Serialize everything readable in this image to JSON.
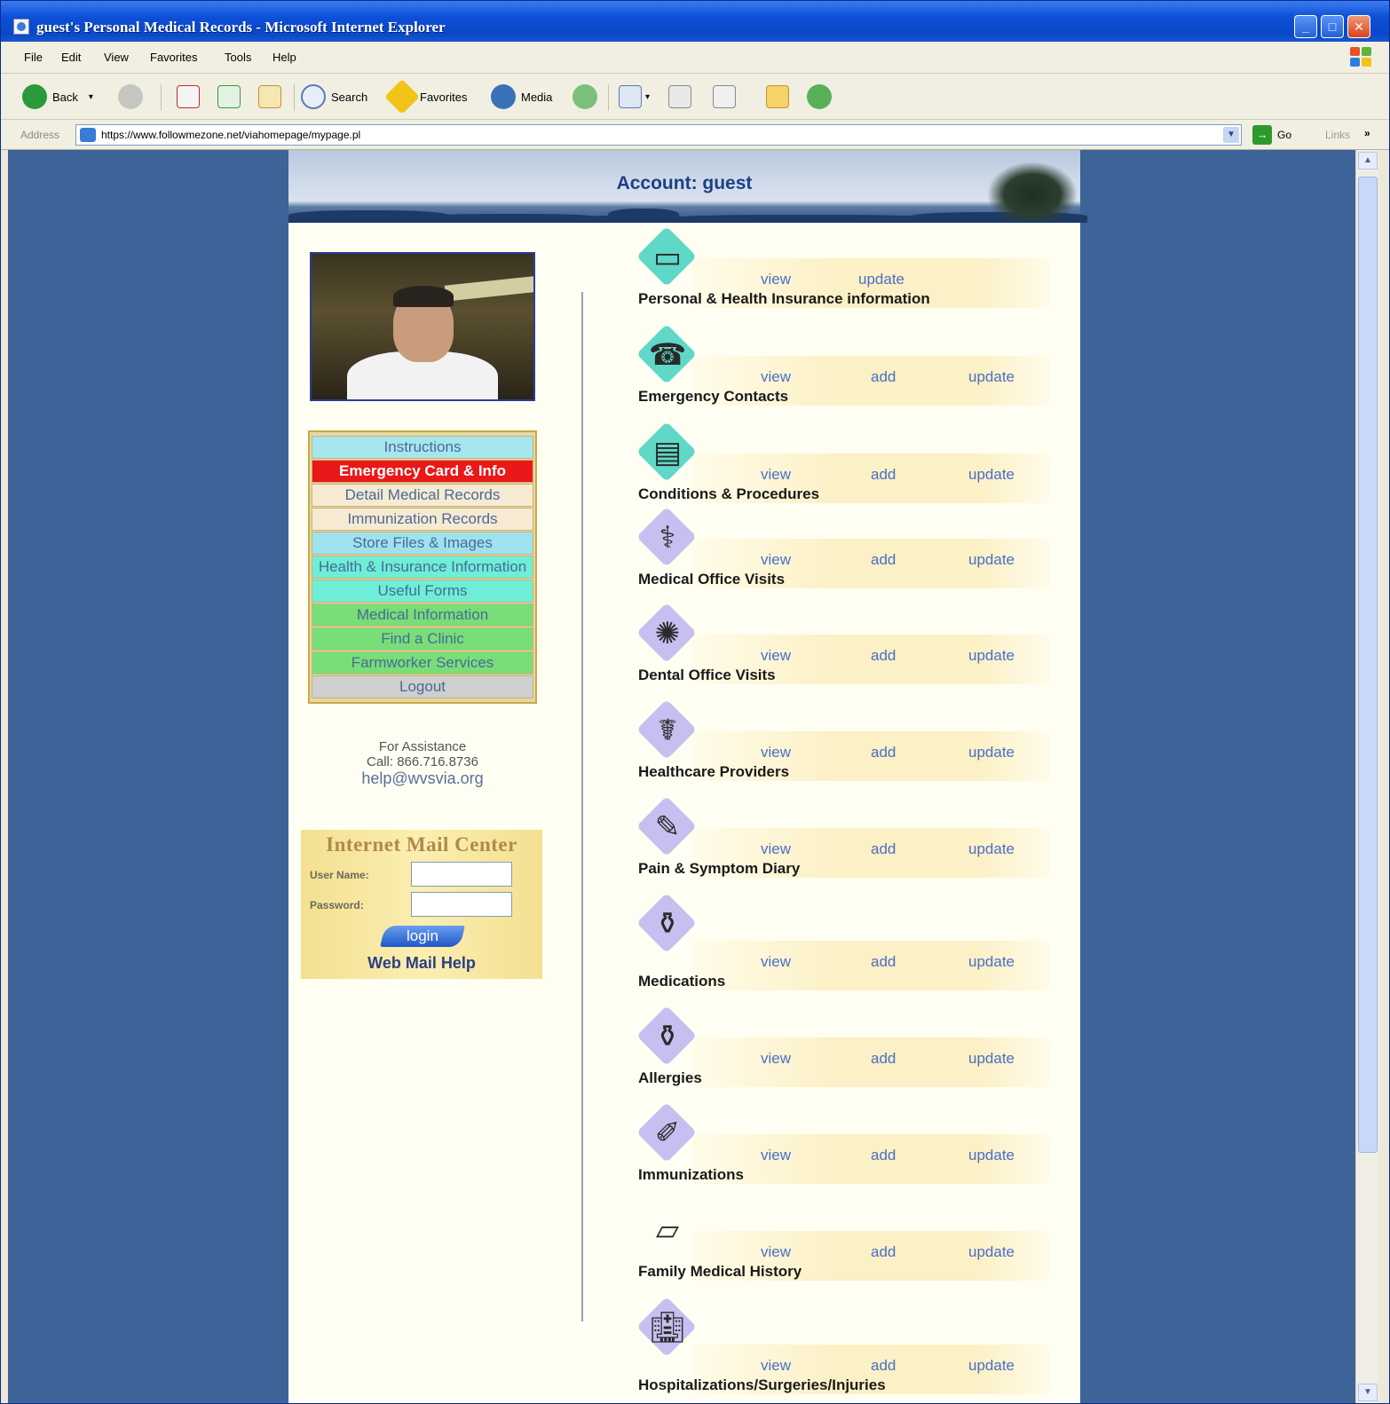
{
  "window": {
    "title": "guest's Personal Medical Records - Microsoft Internet Explorer",
    "controls": {
      "minimize": "_",
      "maximize": "□",
      "close": "✕"
    }
  },
  "menubar": [
    "File",
    "Edit",
    "View",
    "Favorites",
    "Tools",
    "Help"
  ],
  "toolbar": {
    "back": "Back",
    "search": "Search",
    "favorites": "Favorites",
    "media": "Media"
  },
  "address": {
    "label": "Address",
    "url": "https://www.followmezone.net/viahomepage/mypage.pl",
    "go": "Go",
    "links": "Links"
  },
  "banner": {
    "account": "Account: guest"
  },
  "nav": [
    "Instructions",
    "Emergency Card & Info",
    "Detail Medical Records",
    "Immunization Records",
    "Store Files & Images",
    "Health & Insurance Information",
    "Useful Forms",
    "Medical Information",
    "Find a Clinic",
    "Farmworker Services",
    "Logout"
  ],
  "assistance": {
    "line1": "For Assistance",
    "line2": "Call: 866.716.8736",
    "email": "help@wvsvia.org"
  },
  "mail": {
    "title": "Internet Mail Center",
    "username_label": "User Name:",
    "password_label": "Password:",
    "username_value": "",
    "password_value": "",
    "login": "login",
    "help": "Web Mail Help"
  },
  "records": [
    {
      "name": "Personal & Health Insurance information",
      "view": "view",
      "add": "",
      "update": "update",
      "icon": "clipboard-icon"
    },
    {
      "name": "Emergency Contacts",
      "view": "view",
      "add": "add",
      "update": "update",
      "icon": "contacts-icon"
    },
    {
      "name": "Conditions & Procedures",
      "view": "view",
      "add": "add",
      "update": "update",
      "icon": "notebook-icon"
    },
    {
      "name": "Medical Office Visits",
      "view": "view",
      "add": "add",
      "update": "update",
      "icon": "doctor-bag-icon"
    },
    {
      "name": "Dental Office Visits",
      "view": "view",
      "add": "add",
      "update": "update",
      "icon": "tooth-icon"
    },
    {
      "name": "Healthcare Providers",
      "view": "view",
      "add": "add",
      "update": "update",
      "icon": "caduceus-icon"
    },
    {
      "name": "Pain & Symptom Diary",
      "view": "view",
      "add": "add",
      "update": "update",
      "icon": "thermometer-icon"
    },
    {
      "name": "Medications",
      "view": "view",
      "add": "add",
      "update": "update",
      "icon": "pill-bottle-icon"
    },
    {
      "name": "Allergies",
      "view": "view",
      "add": "add",
      "update": "update",
      "icon": "bottle-icon"
    },
    {
      "name": "Immunizations",
      "view": "view",
      "add": "add",
      "update": "update",
      "icon": "syringe-icon"
    },
    {
      "name": "Family Medical History",
      "view": "view",
      "add": "add",
      "update": "update",
      "icon": "folder-icon"
    },
    {
      "name": "Hospitalizations/Surgeries/Injuries",
      "view": "view",
      "add": "add",
      "update": "update",
      "icon": "hospital-icon"
    }
  ],
  "colors": {
    "desktop_blue": "#3d6399",
    "page_bg": "#fffef2",
    "link": "#4a6fc4",
    "emergency_red": "#ea1818",
    "diamond_teal": "#5fd8c8",
    "diamond_lilac": "#c6c0f0"
  }
}
